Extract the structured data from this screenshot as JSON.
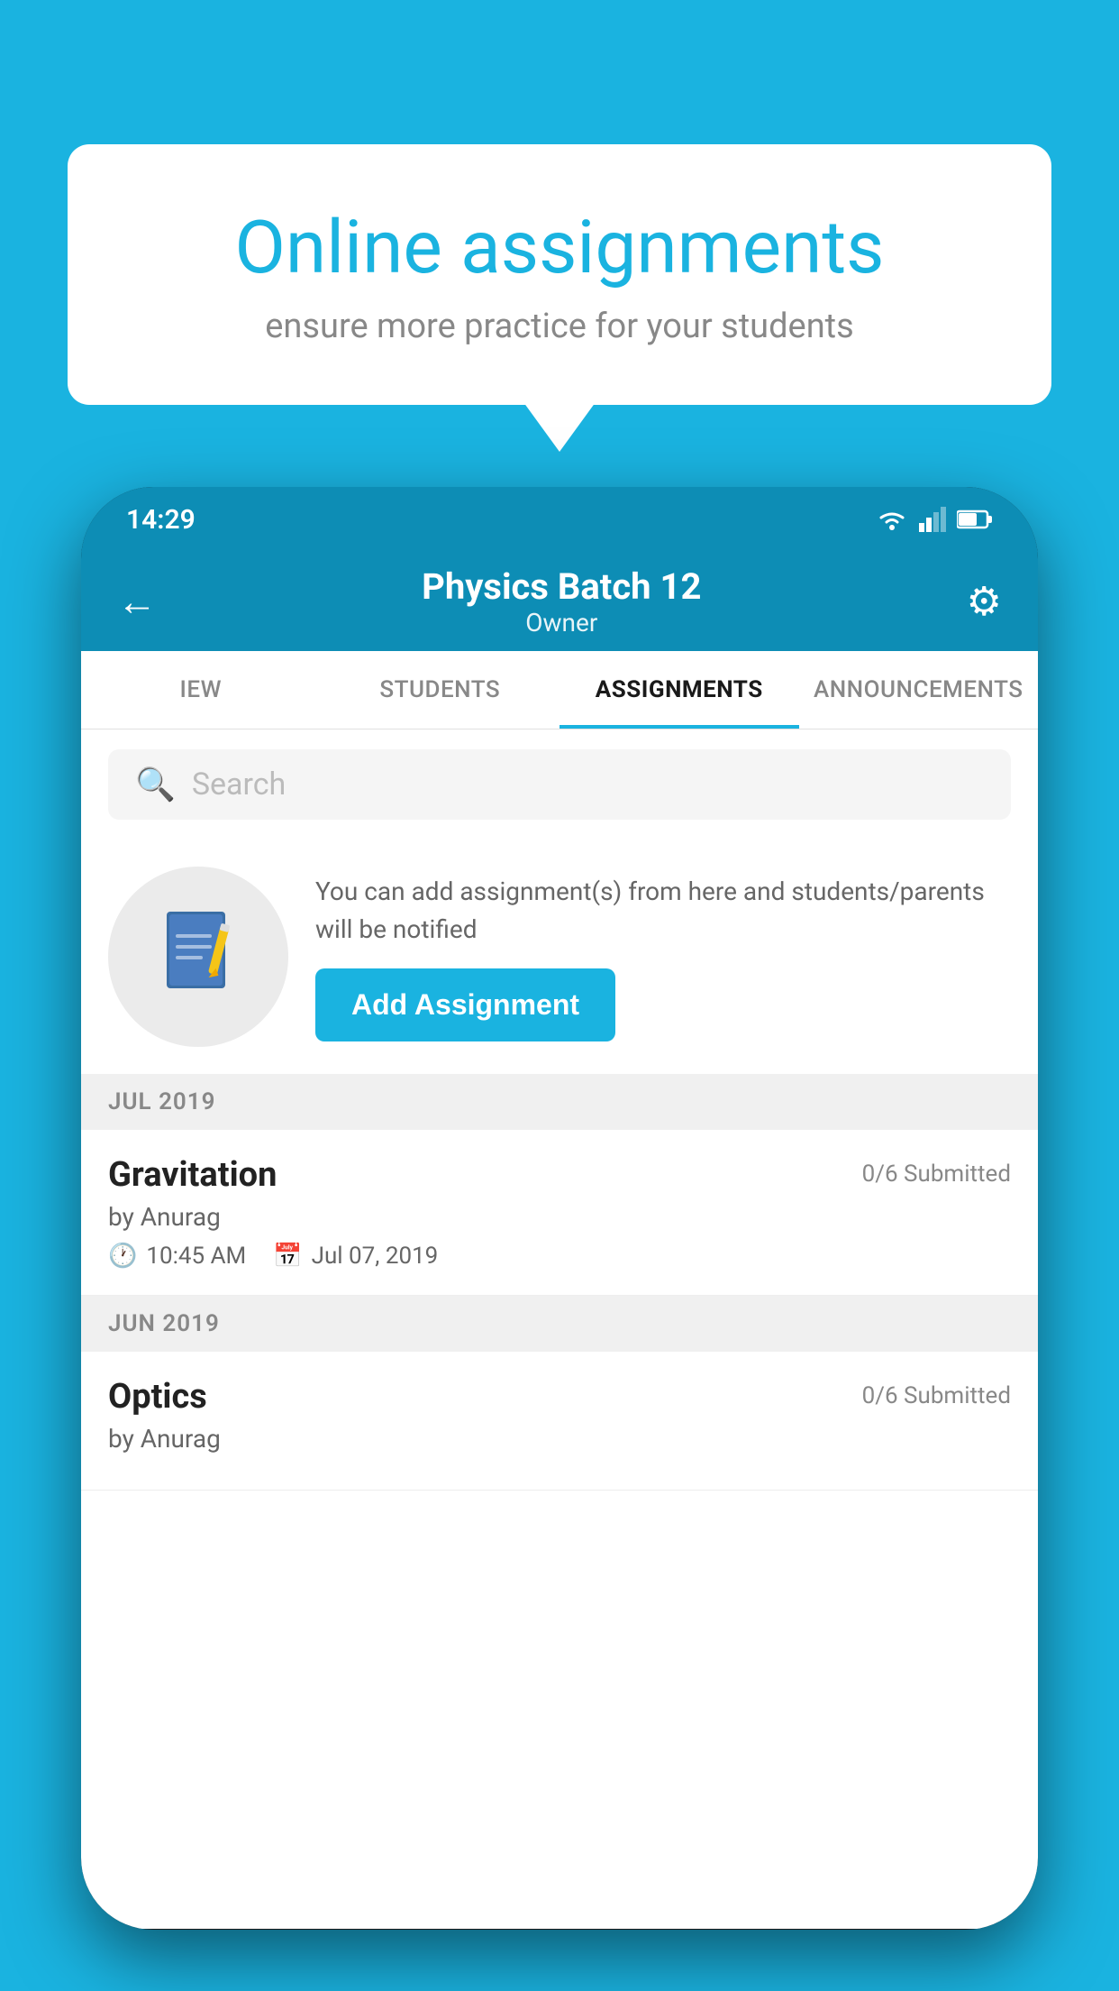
{
  "background_color": "#1ab3e0",
  "speech_bubble": {
    "title": "Online assignments",
    "subtitle": "ensure more practice for your students"
  },
  "phone": {
    "status_bar": {
      "time": "14:29"
    },
    "header": {
      "title": "Physics Batch 12",
      "subtitle": "Owner",
      "back_icon": "←",
      "settings_icon": "⚙"
    },
    "tabs": [
      {
        "label": "IEW",
        "active": false
      },
      {
        "label": "STUDENTS",
        "active": false
      },
      {
        "label": "ASSIGNMENTS",
        "active": true
      },
      {
        "label": "ANNOUNCEMENTS",
        "active": false
      }
    ],
    "search": {
      "placeholder": "Search"
    },
    "promo": {
      "description": "You can add assignment(s) from here and students/parents will be notified",
      "button_label": "Add Assignment"
    },
    "sections": [
      {
        "month": "JUL 2019",
        "assignments": [
          {
            "name": "Gravitation",
            "submitted": "0/6 Submitted",
            "author": "by Anurag",
            "time": "10:45 AM",
            "date": "Jul 07, 2019"
          }
        ]
      },
      {
        "month": "JUN 2019",
        "assignments": [
          {
            "name": "Optics",
            "submitted": "0/6 Submitted",
            "author": "by Anurag",
            "time": "",
            "date": ""
          }
        ]
      }
    ]
  }
}
